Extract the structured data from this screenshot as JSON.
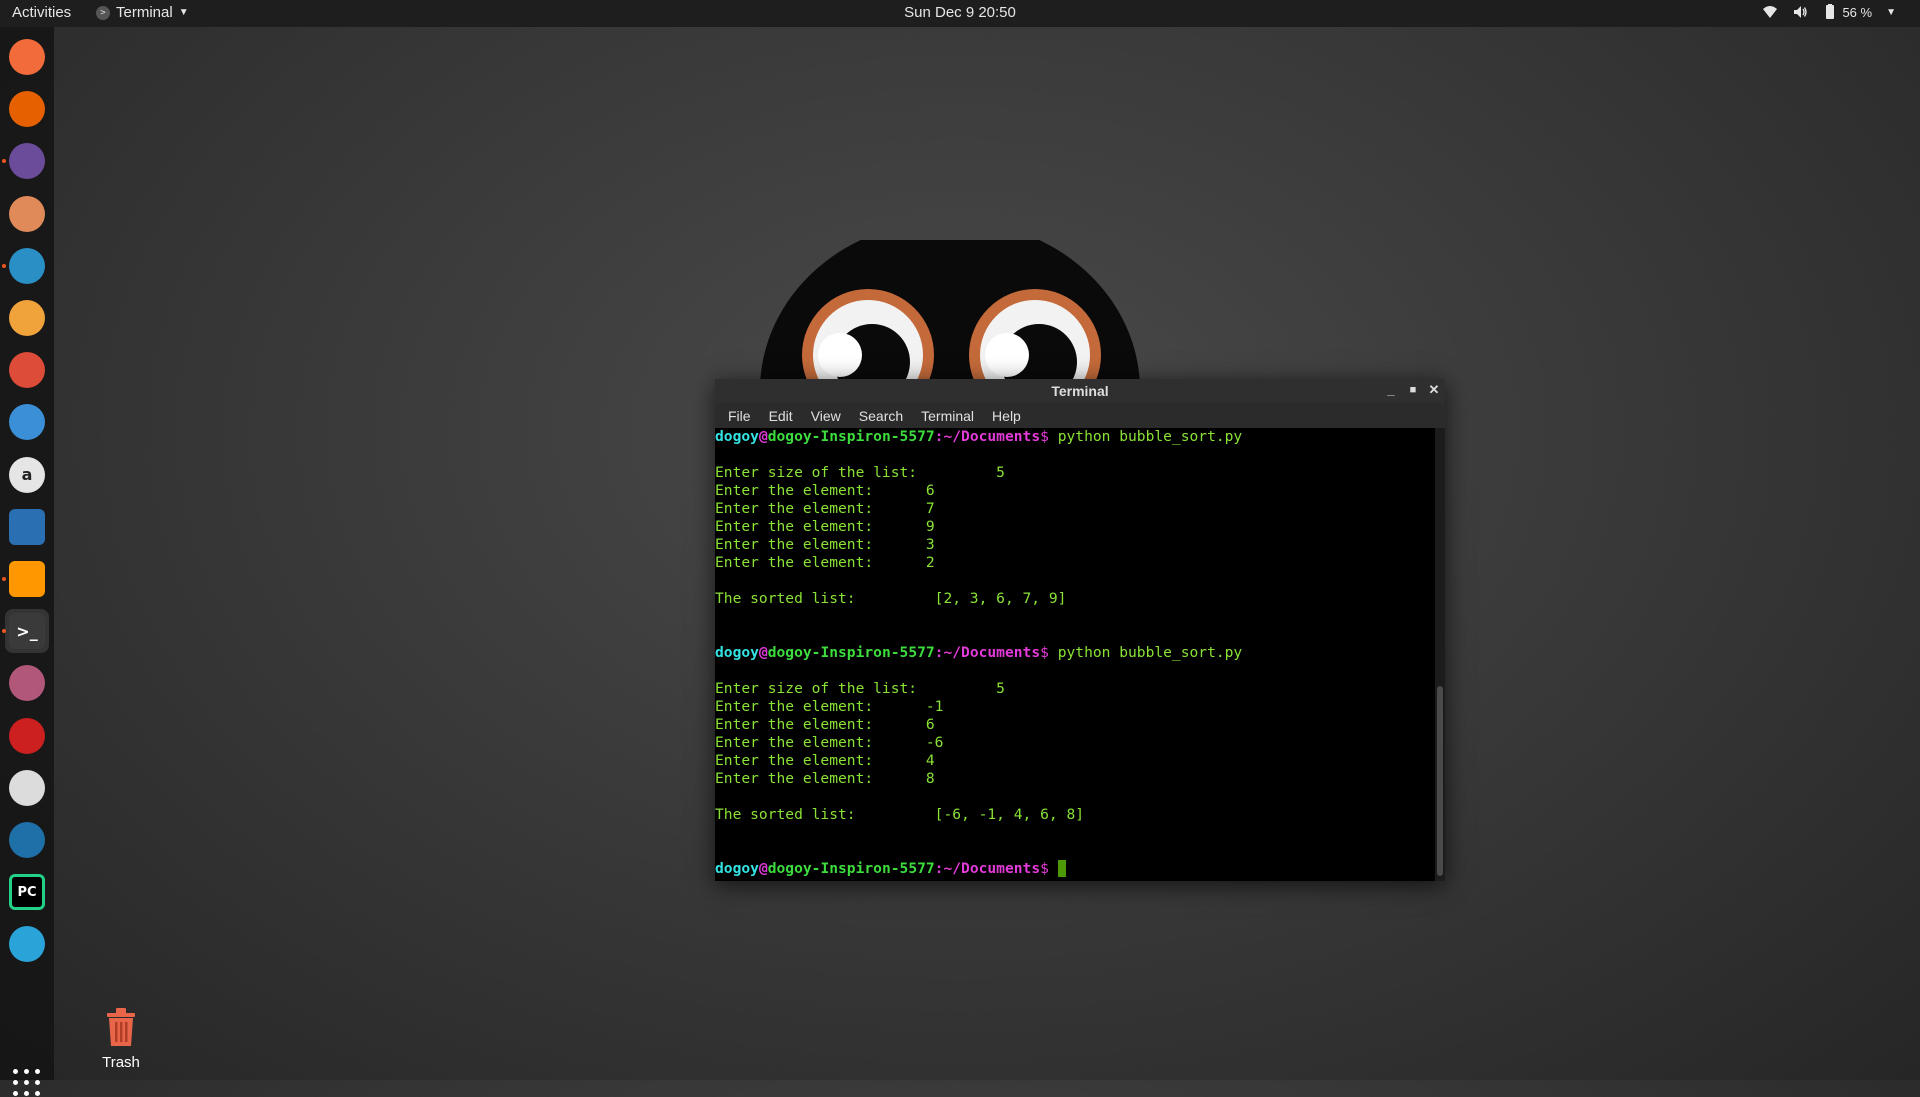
{
  "topbar": {
    "activities": "Activities",
    "app_name": "Terminal",
    "clock": "Sun Dec 9  20:50",
    "battery": "56 %"
  },
  "dock": {
    "items": [
      {
        "name": "todo",
        "icon": "checklist-icon",
        "color": "#f26b3a"
      },
      {
        "name": "firefox",
        "icon": "firefox-icon",
        "color": "#e66000"
      },
      {
        "name": "files",
        "icon": "folder-icon",
        "color": "#6b4c9a"
      },
      {
        "name": "rhythmbox",
        "icon": "speaker-icon",
        "color": "#e08a5a"
      },
      {
        "name": "writer",
        "icon": "document-icon",
        "color": "#2a8fc4"
      },
      {
        "name": "software",
        "icon": "shopping-bag-icon",
        "color": "#f0a33a"
      },
      {
        "name": "chrome",
        "icon": "chrome-icon",
        "color": "#dd4b39"
      },
      {
        "name": "help",
        "icon": "lifebuoy-icon",
        "color": "#3a8fd6"
      },
      {
        "name": "amazon",
        "icon": "amazon-icon",
        "color": "#e5e5e5"
      },
      {
        "name": "vscode",
        "icon": "vscode-icon",
        "color": "#2b6fb3"
      },
      {
        "name": "sublime",
        "icon": "sublime-icon",
        "color": "#ff9800"
      },
      {
        "name": "terminal",
        "icon": "terminal-icon",
        "color": "#3a3a3a"
      },
      {
        "name": "globe",
        "icon": "globe-icon",
        "color": "#b0577a"
      },
      {
        "name": "red-terminal",
        "icon": "red-terminal-icon",
        "color": "#cc1f1f"
      },
      {
        "name": "toggles",
        "icon": "toggle-icon",
        "color": "#dcdcdc"
      },
      {
        "name": "wireshark",
        "icon": "shark-fin-icon",
        "color": "#1f6fa8"
      },
      {
        "name": "pycharm",
        "icon": "pycharm-icon",
        "color": "#22d088"
      },
      {
        "name": "monitor",
        "icon": "system-monitor-icon",
        "color": "#2aa3d8"
      }
    ],
    "labels": {
      "amazon": "a",
      "pycharm": "PC",
      "terminal": ">_"
    }
  },
  "desktop": {
    "trash_label": "Trash"
  },
  "terminal": {
    "title": "Terminal",
    "menu": [
      "File",
      "Edit",
      "View",
      "Search",
      "Terminal",
      "Help"
    ],
    "prompt": {
      "user": "dogoy",
      "at": "@",
      "host": "dogoy-Inspiron-5577",
      "colon": ":",
      "path": "~/Documents",
      "sign": "$"
    },
    "lines": [
      {
        "type": "prompt",
        "cmd": " python bubble_sort.py"
      },
      {
        "type": "blank"
      },
      {
        "type": "out",
        "text": "Enter size of the list:         5"
      },
      {
        "type": "out",
        "text": "Enter the element:      6"
      },
      {
        "type": "out",
        "text": "Enter the element:      7"
      },
      {
        "type": "out",
        "text": "Enter the element:      9"
      },
      {
        "type": "out",
        "text": "Enter the element:      3"
      },
      {
        "type": "out",
        "text": "Enter the element:      2"
      },
      {
        "type": "blank"
      },
      {
        "type": "out",
        "text": "The sorted list:         [2, 3, 6, 7, 9]"
      },
      {
        "type": "blank"
      },
      {
        "type": "blank"
      },
      {
        "type": "prompt",
        "cmd": " python bubble_sort.py"
      },
      {
        "type": "blank"
      },
      {
        "type": "out",
        "text": "Enter size of the list:         5"
      },
      {
        "type": "out",
        "text": "Enter the element:      -1"
      },
      {
        "type": "out",
        "text": "Enter the element:      6"
      },
      {
        "type": "out",
        "text": "Enter the element:      -6"
      },
      {
        "type": "out",
        "text": "Enter the element:      4"
      },
      {
        "type": "out",
        "text": "Enter the element:      8"
      },
      {
        "type": "blank"
      },
      {
        "type": "out",
        "text": "The sorted list:         [-6, -1, 4, 6, 8]"
      },
      {
        "type": "blank"
      },
      {
        "type": "blank"
      },
      {
        "type": "prompt",
        "cmd": " ",
        "cursor": true
      }
    ]
  }
}
